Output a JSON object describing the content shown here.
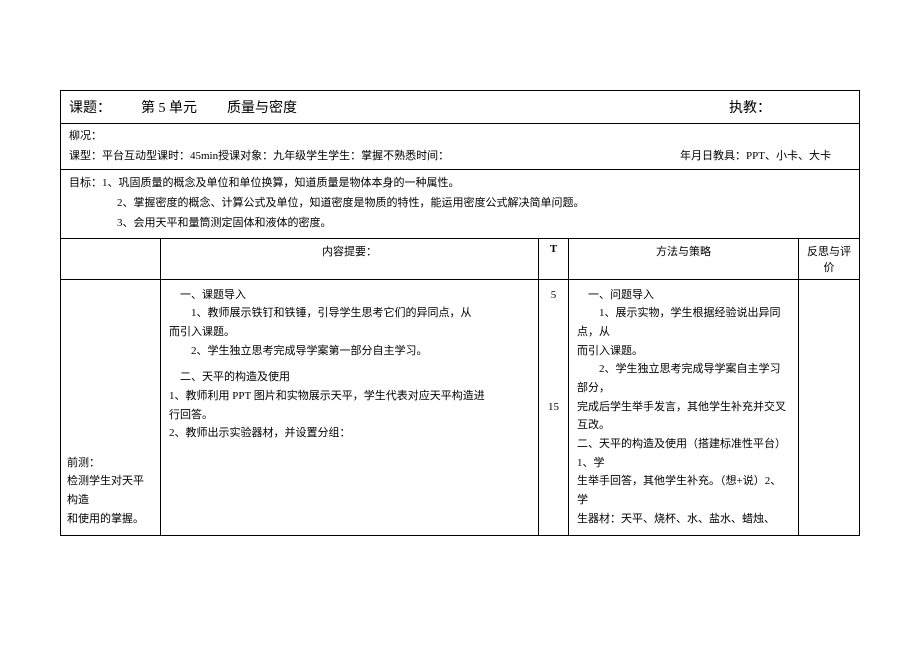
{
  "header": {
    "topic_label": "课题：",
    "unit": "第 5 单元",
    "subject": "质量与密度",
    "teacher_label": "执教："
  },
  "meta": {
    "line1": "柳况：",
    "line2_left": "课型：平台互动型课时：45min授课对象：九年级学生学生：掌握不熟悉时间：",
    "line2_right": "年月日教具：PPT、小卡、大卡"
  },
  "objectives": {
    "obj1": "目标：1、巩固质量的概念及单位和单位换算，知道质量是物体本身的一种属性。",
    "obj2": "2、掌握密度的概念、计算公式及单位，知道密度是物质的特性，能运用密度公式解决简单问题。",
    "obj3": "3、会用天平和量筒测定固体和液体的密度。"
  },
  "table_header": {
    "col_assess": "",
    "col_content": "内容提要：",
    "col_t": "T",
    "col_method": "方法与策略",
    "col_reflect": "反思与评价"
  },
  "body": {
    "assess": {
      "line1": "前测：",
      "line2": "检测学生对天平构造",
      "line3": "和使用的掌握。"
    },
    "content": {
      "sec1_title": "一、课题导入",
      "sec1_item1": "1、教师展示铁钉和铁锤，引导学生思考它们的异同点，从",
      "sec1_item1b": "而引入课题。",
      "sec1_item2": "2、学生独立思考完成导学案第一部分自主学习。",
      "sec2_title": "二、天平的构造及使用",
      "sec2_item1": "1、教师利用 PPT 图片和实物展示天平，学生代表对应天平构造进",
      "sec2_item1b": "行回答。",
      "sec2_item2": "2、教师出示实验器材，并设置分组："
    },
    "t": {
      "val1": "5",
      "val2": "15"
    },
    "method": {
      "sec1_title": "一、问题导入",
      "sec1_item1": "1、展示实物，学生根据经验说出异同点，从",
      "sec1_item1b": "而引入课题。",
      "sec1_item2": "2、学生独立思考完成导学案自主学习部分，",
      "sec1_item2b": "完成后学生举手发言，其他学生补充并交叉互改。",
      "sec2_line1": "二、天平的构造及使用（搭建标准性平台）1、学",
      "sec2_line2": "生举手回答，其他学生补充。（想+说）2、学",
      "sec2_line3": "生器材：天平、烧杯、水、盐水、蜡烛、"
    }
  }
}
